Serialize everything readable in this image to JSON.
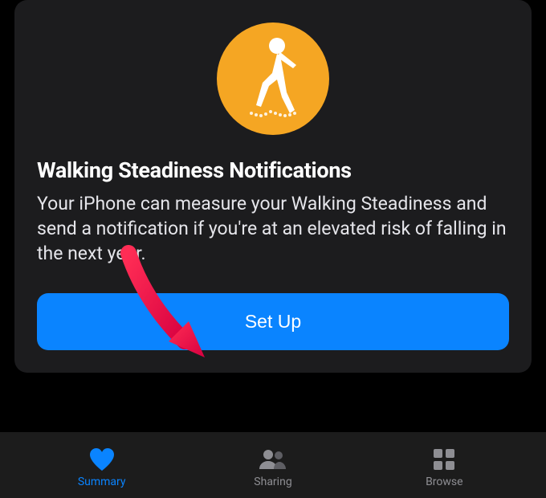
{
  "card": {
    "icon_name": "walking-steadiness-icon",
    "title": "Walking Steadiness Notifications",
    "description": "Your iPhone can measure your Walking Steadiness and send a notification if you're at an elevated risk of falling in the next year.",
    "button_label": "Set Up"
  },
  "tabs": {
    "summary": {
      "label": "Summary",
      "active": true
    },
    "sharing": {
      "label": "Sharing",
      "active": false
    },
    "browse": {
      "label": "Browse",
      "active": false
    }
  },
  "colors": {
    "accent": "#0a84ff",
    "icon_bg": "#f5a623",
    "inactive": "#8e8e93"
  }
}
